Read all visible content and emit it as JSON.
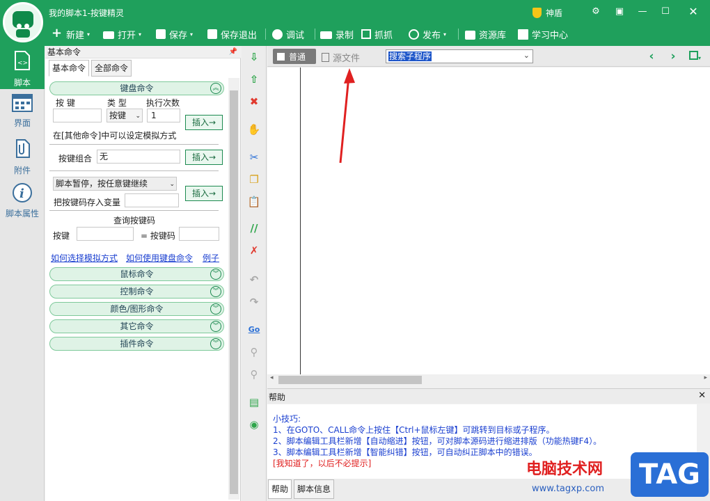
{
  "app": {
    "title": "我的脚本1-按键精灵",
    "vip_label": "神盾"
  },
  "toolbar": {
    "new": "新建",
    "open": "打开",
    "save": "保存",
    "save_exit": "保存退出",
    "debug": "调试",
    "record": "录制",
    "capture": "抓抓",
    "publish": "发布",
    "resources": "资源库",
    "learning": "学习中心"
  },
  "sidebar": {
    "items": [
      {
        "label": "脚本"
      },
      {
        "label": "界面"
      },
      {
        "label": "附件"
      },
      {
        "label": "脚本属性"
      }
    ]
  },
  "panel": {
    "header": "基本命令",
    "tabs": [
      {
        "label": "基本命令"
      },
      {
        "label": "全部命令"
      }
    ],
    "keyboard": {
      "title": "键盘命令",
      "key_label": "按 键",
      "type_label": "类 型",
      "times_label": "执行次数",
      "type_value": "按键",
      "times_value": "1",
      "insert": "插入→",
      "note": "在[其他命令]中可以设定模拟方式",
      "combo_label": "按键组合",
      "combo_value": "无",
      "pause_value": "脚本暂停，按任意键继续",
      "store_label": "把按键码存入变量",
      "query_title": "查询按键码",
      "query_key": "按键",
      "query_eq": "= 按键码"
    },
    "links": [
      "如何选择模拟方式",
      "如何使用键盘命令",
      "例子"
    ],
    "sections": [
      "鼠标命令",
      "控制命令",
      "颜色/图形命令",
      "其它命令",
      "插件命令"
    ]
  },
  "editor": {
    "mode_normal": "普通",
    "mode_source": "源文件",
    "search_value": "搜索子程序"
  },
  "help": {
    "title": "帮助",
    "tips_title": "小技巧:",
    "tips": [
      "1、在GOTO、CALL命令上按住【Ctrl+鼠标左键】可跳转到目标或子程序。",
      "2、脚本编辑工具栏新增【自动缩进】按钮，可对脚本源码进行缩进排版（功能热键F4）。",
      "3、脚本编辑工具栏新增【智能纠错】按钮，可自动纠正脚本中的错误。"
    ],
    "dismiss": "[我知道了，以后不必提示]",
    "tabs": [
      {
        "label": "帮助"
      },
      {
        "label": "脚本信息"
      }
    ]
  },
  "watermark": {
    "site": "电脑技术网",
    "url": "www.tagxp.com",
    "tag": "TAG"
  },
  "colors": {
    "brand": "#1fa05c",
    "link": "#1a3fd0",
    "warn": "#e02020",
    "arrow": "#e02020"
  }
}
